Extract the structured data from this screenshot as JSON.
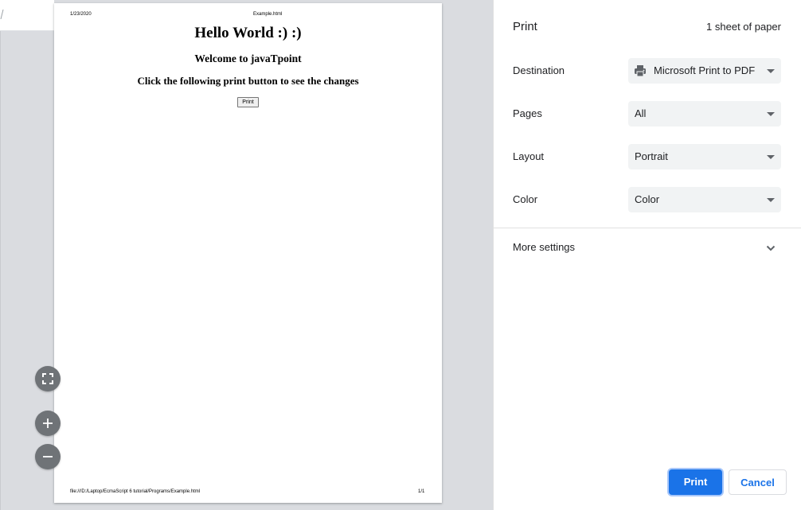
{
  "preview": {
    "header_date": "1/23/2020",
    "header_title": "Example.html",
    "heading1": "Hello World :) :)",
    "heading2": "Welcome to javaTpoint",
    "heading3": "Click the following print button to see the changes",
    "button_label": "Print",
    "footer_url": "file:///D:/Laptop/EcmaScript 6 tutorial/Programs/Example.html",
    "footer_page": "1/1"
  },
  "zoom_controls": {
    "fit": {
      "icon": "fit-to-page-icon"
    },
    "zoom_in": {
      "icon": "plus-icon"
    },
    "zoom_out": {
      "icon": "minus-icon"
    }
  },
  "panel": {
    "title": "Print",
    "sheet_count": "1 sheet of paper",
    "settings": {
      "destination": {
        "label": "Destination",
        "value": "Microsoft Print to PDF",
        "icon": "printer-icon"
      },
      "pages": {
        "label": "Pages",
        "value": "All"
      },
      "layout": {
        "label": "Layout",
        "value": "Portrait"
      },
      "color": {
        "label": "Color",
        "value": "Color"
      }
    },
    "more_settings": {
      "label": "More settings",
      "icon": "chevron-down-icon"
    },
    "print_label": "Print",
    "cancel_label": "Cancel"
  },
  "colors": {
    "accent": "#1a73e8",
    "preview_background": "#dadce0",
    "select_background": "#f1f3f4",
    "zoom_button": "#6f7377"
  }
}
